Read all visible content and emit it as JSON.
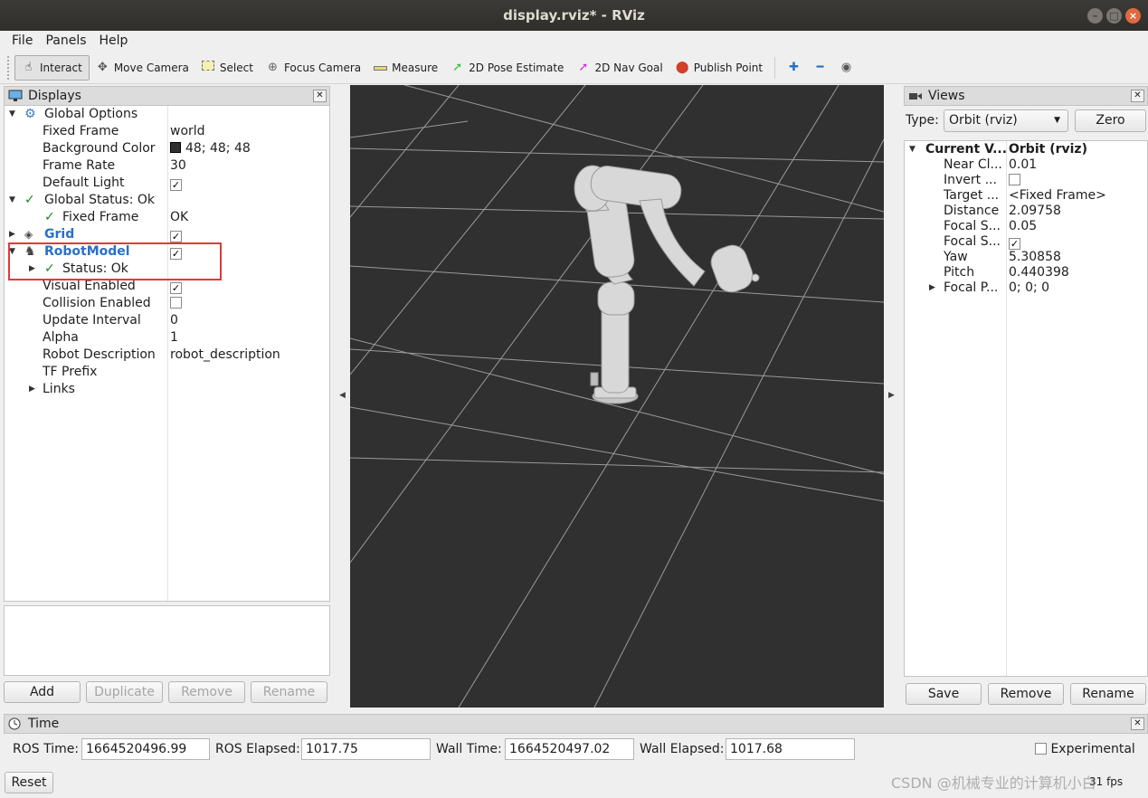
{
  "window": {
    "title": "display.rviz* - RViz",
    "buttons": [
      "–",
      "□",
      "×"
    ]
  },
  "menu": [
    "File",
    "Panels",
    "Help"
  ],
  "toolbar": {
    "tools": [
      {
        "label": "Interact",
        "icon": "hand-icon"
      },
      {
        "label": "Move Camera",
        "icon": "move-camera-icon"
      },
      {
        "label": "Select",
        "icon": "select-icon"
      },
      {
        "label": "Focus Camera",
        "icon": "focus-camera-icon"
      },
      {
        "label": "Measure",
        "icon": "ruler-icon"
      },
      {
        "label": "2D Pose Estimate",
        "icon": "pose-estimate-arrow-icon"
      },
      {
        "label": "2D Nav Goal",
        "icon": "nav-goal-arrow-icon"
      },
      {
        "label": "Publish Point",
        "icon": "map-pin-icon"
      }
    ]
  },
  "displays": {
    "title": "Displays",
    "rows": {
      "global_options": "Global Options",
      "fixed_frame_k": "Fixed Frame",
      "fixed_frame_v": "world",
      "bg_k": "Background Color",
      "bg_v": "48; 48; 48",
      "frame_rate_k": "Frame Rate",
      "frame_rate_v": "30",
      "default_light_k": "Default Light",
      "global_status": "Global Status: Ok",
      "gs_fixed_frame_k": "Fixed Frame",
      "gs_fixed_frame_v": "OK",
      "grid": "Grid",
      "robot_model": "RobotModel",
      "status": "Status: Ok",
      "visual_k": "Visual Enabled",
      "collision_k": "Collision Enabled",
      "update_k": "Update Interval",
      "update_v": "0",
      "alpha_k": "Alpha",
      "alpha_v": "1",
      "robot_desc_k": "Robot Description",
      "robot_desc_v": "robot_description",
      "tf_prefix_k": "TF Prefix",
      "links_k": "Links"
    },
    "buttons": {
      "add": "Add",
      "duplicate": "Duplicate",
      "remove": "Remove",
      "rename": "Rename"
    }
  },
  "views": {
    "title": "Views",
    "type_label": "Type:",
    "type_value": "Orbit (rviz)",
    "zero": "Zero",
    "rows": {
      "current_k": "Current V...",
      "current_v": "Orbit (rviz)",
      "near_k": "Near Cl...",
      "near_v": "0.01",
      "invert_k": "Invert ...",
      "target_k": "Target ...",
      "target_v": "<Fixed Frame>",
      "distance_k": "Distance",
      "distance_v": "2.09758",
      "focal1_k": "Focal S...",
      "focal1_v": "0.05",
      "focal2_k": "Focal S...",
      "yaw_k": "Yaw",
      "yaw_v": "5.30858",
      "pitch_k": "Pitch",
      "pitch_v": "0.440398",
      "focalp_k": "Focal P...",
      "focalp_v": "0; 0; 0"
    },
    "buttons": {
      "save": "Save",
      "remove": "Remove",
      "rename": "Rename"
    }
  },
  "time": {
    "title": "Time",
    "ros_time_label": "ROS Time:",
    "ros_time": "1664520496.99",
    "ros_elapsed_label": "ROS Elapsed:",
    "ros_elapsed": "1017.75",
    "wall_time_label": "Wall Time:",
    "wall_time": "1664520497.02",
    "wall_elapsed_label": "Wall Elapsed:",
    "wall_elapsed": "1017.68",
    "experimental": "Experimental",
    "reset": "Reset",
    "fps": "31 fps"
  },
  "watermark": "CSDN @机械专业的计算机小白",
  "colors": {
    "view_bg": "#303030",
    "highlight": "#e03a3a",
    "ok_green": "#1a8a1a",
    "link_blue": "#2a6fc9"
  }
}
